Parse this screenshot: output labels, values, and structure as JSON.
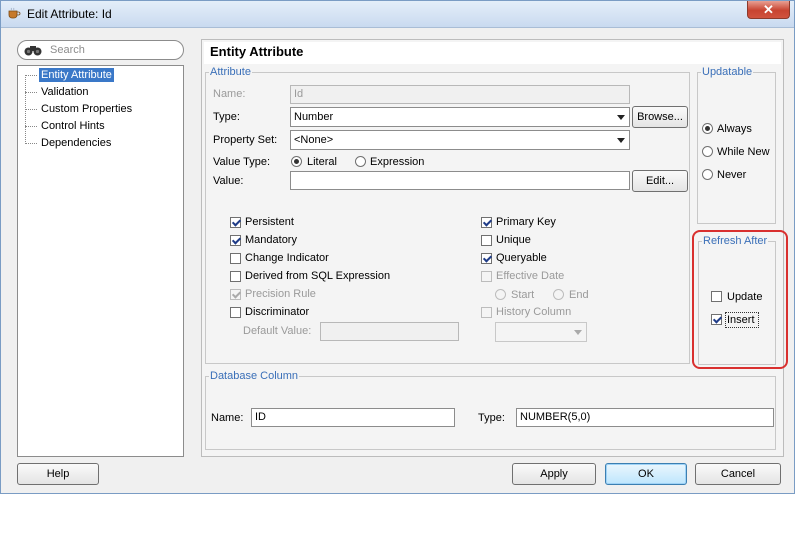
{
  "window": {
    "title": "Edit Attribute: Id",
    "close_glyph": "✕"
  },
  "search": {
    "placeholder": "Search"
  },
  "tree": {
    "items": [
      {
        "label": "Entity Attribute",
        "selected": true
      },
      {
        "label": "Validation"
      },
      {
        "label": "Custom Properties"
      },
      {
        "label": "Control Hints"
      },
      {
        "label": "Dependencies"
      }
    ]
  },
  "panel": {
    "title": "Entity Attribute"
  },
  "attribute": {
    "legend": "Attribute",
    "name_label": "Name:",
    "name_value": "Id",
    "type_label": "Type:",
    "type_value": "Number",
    "browse_label": "Browse...",
    "property_set_label": "Property Set:",
    "property_set_value": "<None>",
    "value_type_label": "Value Type:",
    "literal_label": "Literal",
    "expression_label": "Expression",
    "value_type_selected": "Literal",
    "value_label": "Value:",
    "value_value": "",
    "edit_label": "Edit...",
    "checkboxes": {
      "persistent": {
        "label": "Persistent",
        "checked": true
      },
      "mandatory": {
        "label": "Mandatory",
        "checked": true
      },
      "change_indicator": {
        "label": "Change Indicator",
        "checked": false
      },
      "derived": {
        "label": "Derived from SQL Expression",
        "checked": false
      },
      "precision_rule": {
        "label": "Precision Rule",
        "checked": true,
        "disabled": true
      },
      "discriminator": {
        "label": "Discriminator",
        "checked": false
      },
      "primary_key": {
        "label": "Primary Key",
        "checked": true
      },
      "unique": {
        "label": "Unique",
        "checked": false
      },
      "queryable": {
        "label": "Queryable",
        "checked": true
      },
      "effective_date": {
        "label": "Effective Date",
        "checked": false,
        "disabled": true
      },
      "history_column": {
        "label": "History Column",
        "checked": false,
        "disabled": true
      }
    },
    "start_label": "Start",
    "end_label": "End",
    "default_value_label": "Default Value:",
    "default_value": ""
  },
  "updatable": {
    "legend": "Updatable",
    "options": [
      "Always",
      "While New",
      "Never"
    ],
    "selected": "Always"
  },
  "refresh_after": {
    "legend": "Refresh After",
    "update": {
      "label": "Update",
      "checked": false
    },
    "insert": {
      "label": "Insert",
      "checked": true
    }
  },
  "database_column": {
    "legend": "Database Column",
    "name_label": "Name:",
    "name_value": "ID",
    "type_label": "Type:",
    "type_value": "NUMBER(5,0)"
  },
  "buttons": {
    "help": "Help",
    "apply": "Apply",
    "ok": "OK",
    "cancel": "Cancel"
  },
  "colors": {
    "legend": "#3a6fb8",
    "highlight": "#d9302f",
    "selection": "#3a78c8"
  }
}
